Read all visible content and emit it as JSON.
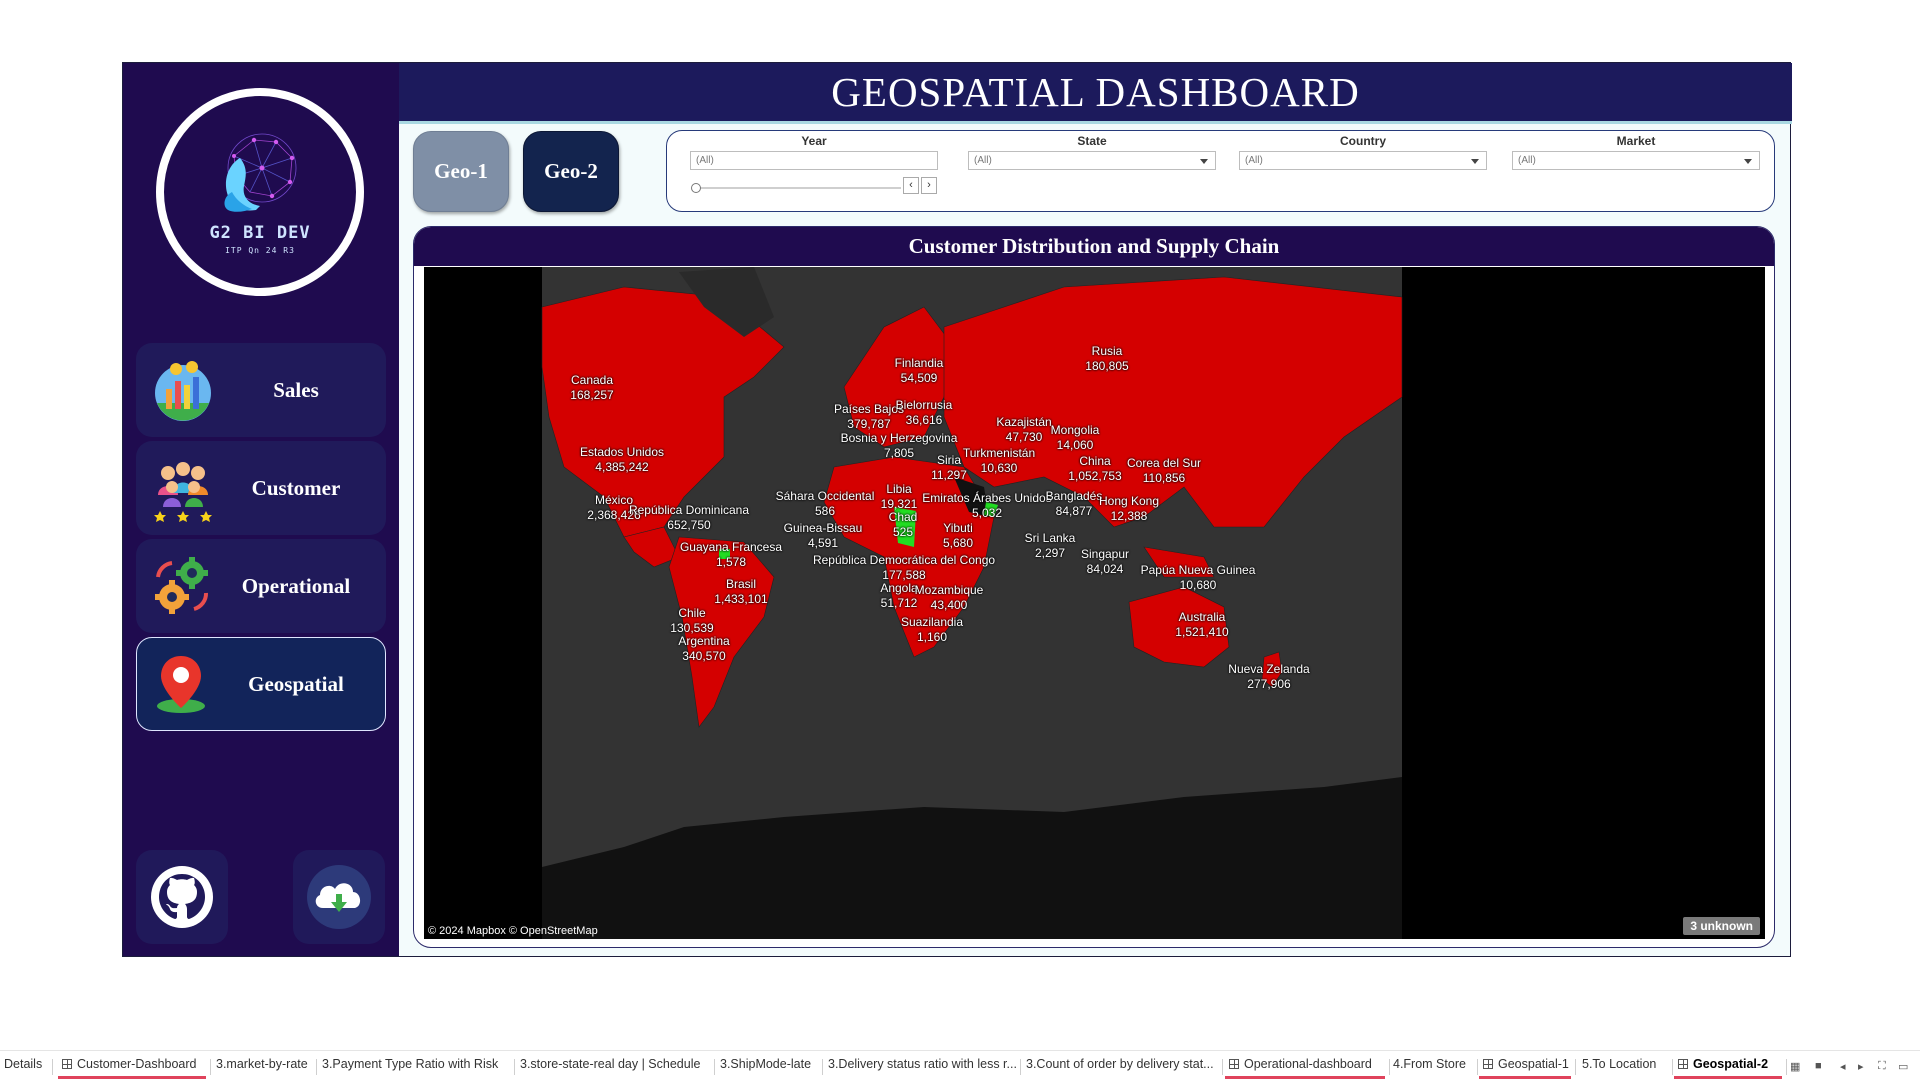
{
  "header": {
    "title": "GEOSPATIAL DASHBOARD"
  },
  "logo": {
    "name": "G2 BI DEV",
    "subtitle": "ITP Qn 24 R3"
  },
  "nav": [
    {
      "label": "Sales",
      "icon": "bar-chart-coins-icon"
    },
    {
      "label": "Customer",
      "icon": "customers-stars-icon"
    },
    {
      "label": "Operational",
      "icon": "gears-icon"
    },
    {
      "label": "Geospatial",
      "icon": "map-pin-icon",
      "active": true
    }
  ],
  "social": {
    "github": "github-icon",
    "download": "cloud-download-icon"
  },
  "geo_buttons": {
    "geo1": "Geo-1",
    "geo2": "Geo-2"
  },
  "filters": {
    "year": {
      "label": "Year",
      "value": "(All)"
    },
    "state": {
      "label": "State",
      "value": "(All)"
    },
    "country": {
      "label": "Country",
      "value": "(All)"
    },
    "market": {
      "label": "Market",
      "value": "(All)"
    }
  },
  "map": {
    "title": "Customer Distribution and Supply Chain",
    "attribution": "© 2024 Mapbox © OpenStreetMap",
    "unknown": "3 unknown",
    "colors": {
      "country_fill": "#d40000",
      "highlight_fill": "#22dd22",
      "land_other": "#2a2a2a",
      "ocean": "#333333"
    },
    "labels": [
      {
        "name": "Canada",
        "value": "168,257"
      },
      {
        "name": "Estados Unidos",
        "value": "4,385,242"
      },
      {
        "name": "México",
        "value": "2,368,426"
      },
      {
        "name": "República Dominicana",
        "value": "652,750"
      },
      {
        "name": "Guayana Francesa",
        "value": "1,578"
      },
      {
        "name": "Brasil",
        "value": "1,433,101"
      },
      {
        "name": "Chile",
        "value": "130,539"
      },
      {
        "name": "Argentina",
        "value": "340,570"
      },
      {
        "name": "Finlandia",
        "value": "54,509"
      },
      {
        "name": "Países Bajos",
        "value": "379,787"
      },
      {
        "name": "Bielorrusia",
        "value": "36,616"
      },
      {
        "name": "Bosnia y Herzegovina",
        "value": "7,805"
      },
      {
        "name": "Rusia",
        "value": "180,805"
      },
      {
        "name": "Kazajistán",
        "value": "47,730"
      },
      {
        "name": "Mongolia",
        "value": "14,060"
      },
      {
        "name": "Turkmenistán",
        "value": "10,630"
      },
      {
        "name": "Siria",
        "value": "11,297"
      },
      {
        "name": "China",
        "value": "1,052,753"
      },
      {
        "name": "Corea del Sur",
        "value": "110,856"
      },
      {
        "name": "Sáhara Occidental",
        "value": "586"
      },
      {
        "name": "Libia",
        "value": "19,321"
      },
      {
        "name": "Emiratos Árabes Unidos",
        "value": "5,032"
      },
      {
        "name": "Bangladés",
        "value": "84,877"
      },
      {
        "name": "Hong Kong",
        "value": "12,388"
      },
      {
        "name": "Chad",
        "value": "525"
      },
      {
        "name": "Guinea-Bissau",
        "value": "4,591"
      },
      {
        "name": "Yibuti",
        "value": "5,680"
      },
      {
        "name": "Sri Lanka",
        "value": "2,297"
      },
      {
        "name": "Singapur",
        "value": "84,024"
      },
      {
        "name": "Papúa Nueva Guinea",
        "value": "10,680"
      },
      {
        "name": "República Democrática del Congo",
        "value": "177,588"
      },
      {
        "name": "Angola",
        "value": "51,712"
      },
      {
        "name": "Mozambique",
        "value": "43,400"
      },
      {
        "name": "Suazilandia",
        "value": "1,160"
      },
      {
        "name": "Australia",
        "value": "1,521,410"
      },
      {
        "name": "Nueva Zelanda",
        "value": "277,906"
      }
    ]
  },
  "tabs": [
    {
      "label": "Details"
    },
    {
      "label": "Customer-Dashboard",
      "dashboard": true
    },
    {
      "label": "3.market-by-rate"
    },
    {
      "label": "3.Payment Type Ratio with Risk"
    },
    {
      "label": "3.store-state-real day | Schedule"
    },
    {
      "label": "3.ShipMode-late"
    },
    {
      "label": "3.Delivery status ratio with less r..."
    },
    {
      "label": "3.Count of order by delivery stat..."
    },
    {
      "label": "Operational-dashboard",
      "dashboard": true
    },
    {
      "label": "4.From Store"
    },
    {
      "label": "Geospatial-1",
      "dashboard": true
    },
    {
      "label": "5.To Location"
    },
    {
      "label": "Geospatial-2",
      "dashboard": true,
      "current": true
    }
  ]
}
